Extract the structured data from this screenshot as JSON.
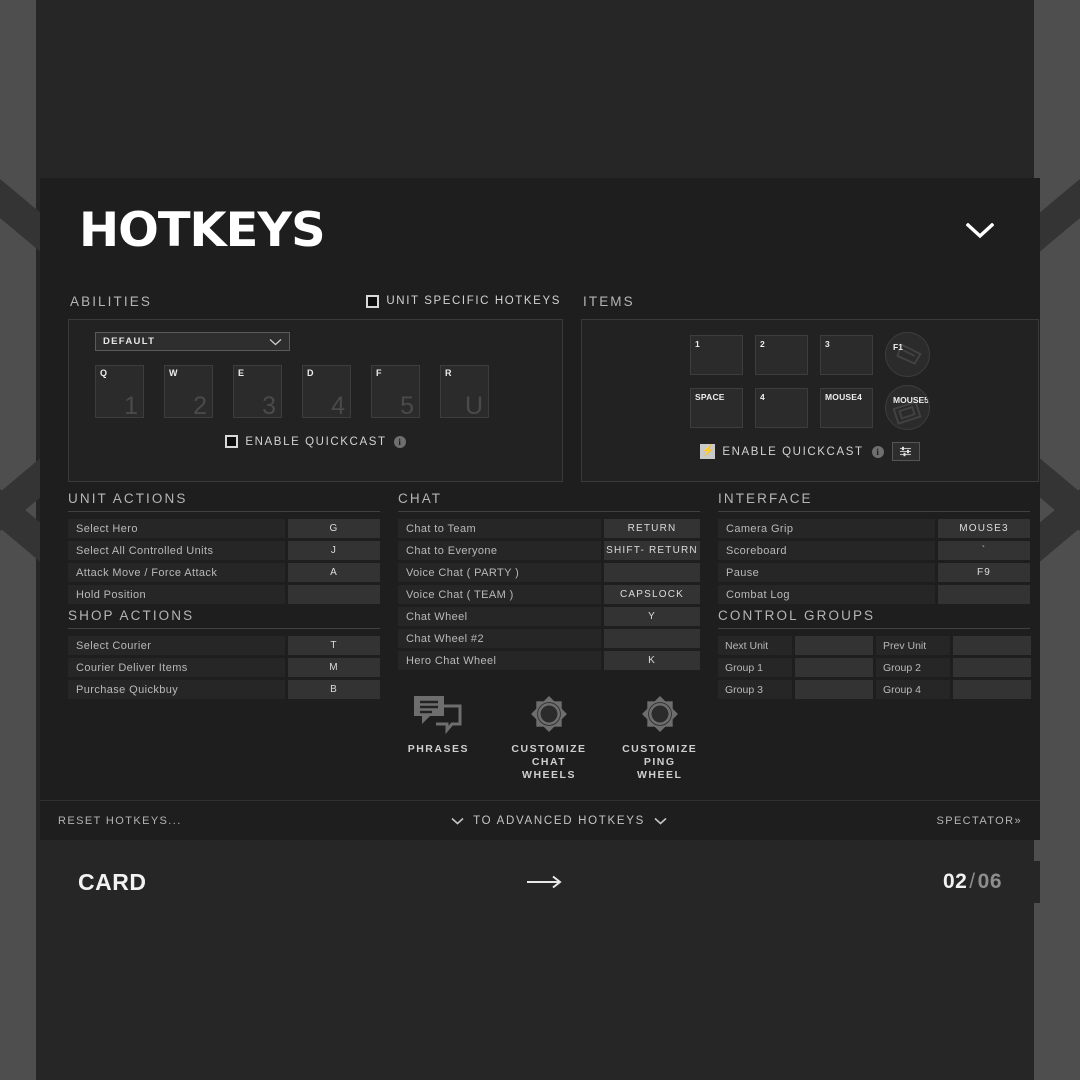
{
  "background": {
    "band_color": "#4e4e4e",
    "page_color": "#262626"
  },
  "card": {
    "title": "HOTKEYS",
    "collapse_icon": "chevron-down-icon",
    "footer": {
      "reset_label": "RESET HOTKEYS...",
      "advanced_label": "TO ADVANCED HOTKEYS",
      "advanced_caret_icon": "chevron-down-icon",
      "spectator_label": "SPECTATOR",
      "spectator_icon": "double-chevron-right-icon"
    }
  },
  "abilities": {
    "heading": "ABILITIES",
    "unit_specific": {
      "label": "UNIT SPECIFIC HOTKEYS",
      "checked": true
    },
    "preset": {
      "value": "DEFAULT",
      "caret_icon": "chevron-down-icon"
    },
    "slots": [
      {
        "key": "Q",
        "ghost": "1"
      },
      {
        "key": "W",
        "ghost": "2"
      },
      {
        "key": "E",
        "ghost": "3"
      },
      {
        "key": "D",
        "ghost": "4"
      },
      {
        "key": "F",
        "ghost": "5"
      },
      {
        "key": "R",
        "ghost": "U"
      }
    ],
    "quickcast": {
      "label": "ENABLE QUICKCAST",
      "checked": false,
      "info_icon": "info-icon"
    }
  },
  "items": {
    "heading": "ITEMS",
    "row1": [
      {
        "key": "1",
        "shape": "square"
      },
      {
        "key": "2",
        "shape": "square"
      },
      {
        "key": "3",
        "shape": "square"
      },
      {
        "key": "F1",
        "shape": "circle"
      }
    ],
    "row2": [
      {
        "key": "SPACE",
        "shape": "square"
      },
      {
        "key": "4",
        "shape": "square"
      },
      {
        "key": "MOUSE4",
        "shape": "square"
      },
      {
        "key": "MOUSE5",
        "shape": "circle"
      }
    ],
    "quickcast": {
      "label": "ENABLE QUICKCAST",
      "checked": true,
      "check_icon": "lightning-bolt-icon",
      "info_icon": "info-icon",
      "settings_icon": "sliders-icon"
    }
  },
  "unit_actions": {
    "heading": "UNIT ACTIONS",
    "rows": [
      {
        "name": "Select Hero",
        "key": "G"
      },
      {
        "name": "Select All Controlled Units",
        "key": "J"
      },
      {
        "name": "Attack Move / Force Attack",
        "key": "A"
      },
      {
        "name": "Hold Position",
        "key": ""
      }
    ]
  },
  "shop_actions": {
    "heading": "SHOP ACTIONS",
    "rows": [
      {
        "name": "Select Courier",
        "key": "T"
      },
      {
        "name": "Courier Deliver Items",
        "key": "M"
      },
      {
        "name": "Purchase Quickbuy",
        "key": "B"
      }
    ]
  },
  "chat": {
    "heading": "CHAT",
    "rows": [
      {
        "name": "Chat to Team",
        "key": "RETURN"
      },
      {
        "name": "Chat to Everyone",
        "key": "SHIFT- RETURN"
      },
      {
        "name": "Voice Chat ( PARTY )",
        "key": ""
      },
      {
        "name": "Voice Chat ( TEAM )",
        "key": "CAPSLOCK"
      },
      {
        "name": "Chat Wheel",
        "key": "Y"
      },
      {
        "name": "Chat Wheel #2",
        "key": ""
      },
      {
        "name": "Hero Chat Wheel",
        "key": "K"
      }
    ],
    "wheel_buttons": [
      {
        "label": "PHRASES",
        "icon": "speech-bubbles-icon"
      },
      {
        "label": "CUSTOMIZE\nCHAT WHEELS",
        "line1": "CUSTOMIZE",
        "line2": "CHAT WHEELS",
        "icon": "chat-wheel-icon"
      },
      {
        "label": "CUSTOMIZE\nPING WHEEL",
        "line1": "CUSTOMIZE",
        "line2": "PING WHEEL",
        "icon": "ping-wheel-icon"
      }
    ]
  },
  "interface": {
    "heading": "INTERFACE",
    "rows": [
      {
        "name": "Camera Grip",
        "key": "MOUSE3"
      },
      {
        "name": "Scoreboard",
        "key": "`"
      },
      {
        "name": "Pause",
        "key": "F9"
      },
      {
        "name": "Combat Log",
        "key": ""
      }
    ]
  },
  "control_groups": {
    "heading": "CONTROL GROUPS",
    "rows": [
      {
        "left_name": "Next Unit",
        "left_key": "",
        "right_name": "Prev Unit",
        "right_key": ""
      },
      {
        "left_name": "Group 1",
        "left_key": "",
        "right_name": "Group 2",
        "right_key": ""
      },
      {
        "left_name": "Group 3",
        "left_key": "",
        "right_name": "Group 4",
        "right_key": ""
      }
    ]
  },
  "card_bar": {
    "label": "CARD",
    "arrow_icon": "arrow-right-icon",
    "current": "02",
    "separator": "/",
    "total": "06"
  }
}
